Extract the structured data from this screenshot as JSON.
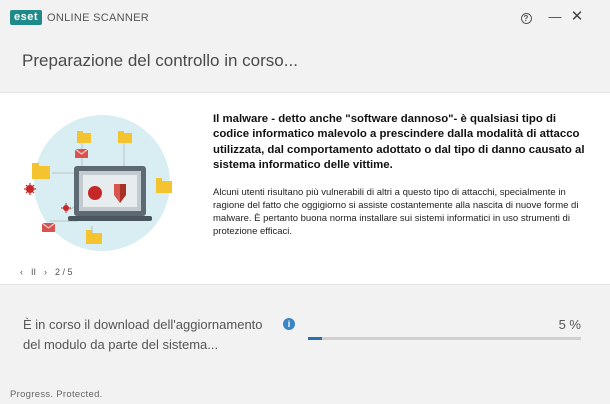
{
  "app": {
    "brand": "eset",
    "product": "ONLINE SCANNER"
  },
  "window_controls": {
    "help": "?",
    "minimize": "—",
    "close": "✕"
  },
  "header": {
    "title": "Preparazione del controllo in corso..."
  },
  "slide": {
    "headline": "Il malware - detto anche  \"software dannoso\"- è qualsiasi tipo di codice informatico malevolo a prescindere dalla modalità di attacco utilizzata, dal comportamento adottato o dal tipo di danno causato al sistema informatico delle vittime.",
    "body": "Alcuni utenti risultano più vulnerabili di altri a questo tipo di attacchi, specialmente in ragione del fatto che oggigiorno si assiste costantemente alla nascita di nuove forme di malware. È pertanto buona norma installare sui sistemi informatici in uso strumenti di protezione efficaci.",
    "pager": {
      "prev": "‹",
      "pause": "II",
      "next": "›",
      "position": "2 / 5"
    }
  },
  "status": {
    "text": "È in corso il download dell'aggiornamento del modulo da parte del sistema...",
    "percent_label": "5 %",
    "progress_fraction": 0.05,
    "info_icon": "i"
  },
  "footer": {
    "tagline": "Progress. Protected."
  },
  "colors": {
    "brand": "#1f8a8a",
    "progress": "#2a70b0",
    "info": "#3a85c5",
    "illus_bg": "#d9eef2",
    "folder": "#f4c430",
    "mail": "#d9534f"
  }
}
